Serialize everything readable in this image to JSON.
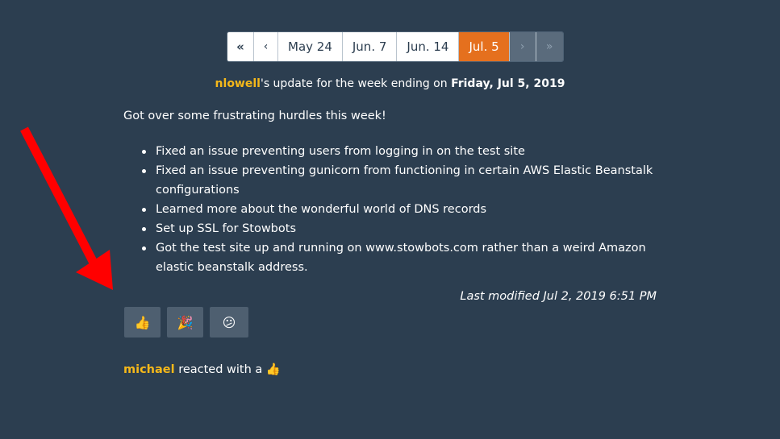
{
  "pagination": {
    "first": "«",
    "prev": "‹",
    "pages": [
      "May 24",
      "Jun. 7",
      "Jun. 14",
      "Jul. 5"
    ],
    "next": "›",
    "last": "»",
    "active_index": 3
  },
  "update": {
    "username": "nlowell",
    "text": "'s update for the week ending on ",
    "date": "Friday, Jul 5, 2019"
  },
  "intro": "Got over some frustrating hurdles this week!",
  "items": [
    "Fixed an issue preventing users from logging in on the test site",
    "Fixed an issue preventing gunicorn from functioning in certain AWS Elastic Beanstalk configurations",
    "Learned more about the wonderful world of DNS records",
    "Set up SSL for Stowbots",
    "Got the test site up and running on www.stowbots.com rather than a weird Amazon elastic beanstalk address."
  ],
  "modified": "Last modified Jul 2, 2019 6:51 PM",
  "reactions": [
    {
      "icon": "thumbs-up",
      "glyph": "👍"
    },
    {
      "icon": "party-popper",
      "glyph": "🎉"
    },
    {
      "icon": "confused-face",
      "glyph": "😕"
    }
  ],
  "reaction_log": {
    "username": "michael",
    "text": " reacted with a ",
    "glyph": "👍"
  },
  "colors": {
    "background": "#2c3e50",
    "accent": "#e5701e",
    "username": "#f5b81a",
    "arrow": "#ff0000"
  }
}
